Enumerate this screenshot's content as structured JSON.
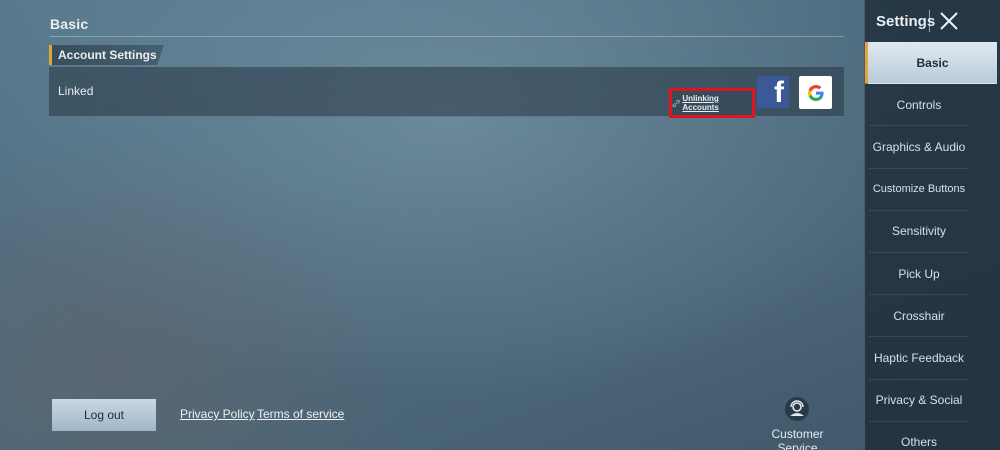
{
  "main": {
    "section_title": "Basic",
    "group_header": "Account Settings",
    "linked_label": "Linked",
    "unlink_label": "Unlinking Accounts",
    "facebook_glyph": "f",
    "google_glyph": "G"
  },
  "footer": {
    "logout_label": "Log out",
    "privacy_label": "Privacy Policy",
    "terms_label": "Terms of service",
    "customer_service_label": "Customer Service"
  },
  "sidebar": {
    "title": "Settings",
    "items": [
      {
        "label": "Basic"
      },
      {
        "label": "Controls"
      },
      {
        "label": "Graphics & Audio"
      },
      {
        "label": "Customize Buttons"
      },
      {
        "label": "Sensitivity"
      },
      {
        "label": "Pick Up"
      },
      {
        "label": "Crosshair"
      },
      {
        "label": "Haptic Feedback"
      },
      {
        "label": "Privacy & Social"
      },
      {
        "label": "Others"
      }
    ],
    "active_index": 0
  },
  "colors": {
    "accent": "#e3a63a",
    "highlight_border": "#e0141e",
    "facebook": "#3b5998"
  },
  "icons": [
    "close-icon",
    "link-icon",
    "facebook-icon",
    "google-icon",
    "customer-service-icon"
  ]
}
